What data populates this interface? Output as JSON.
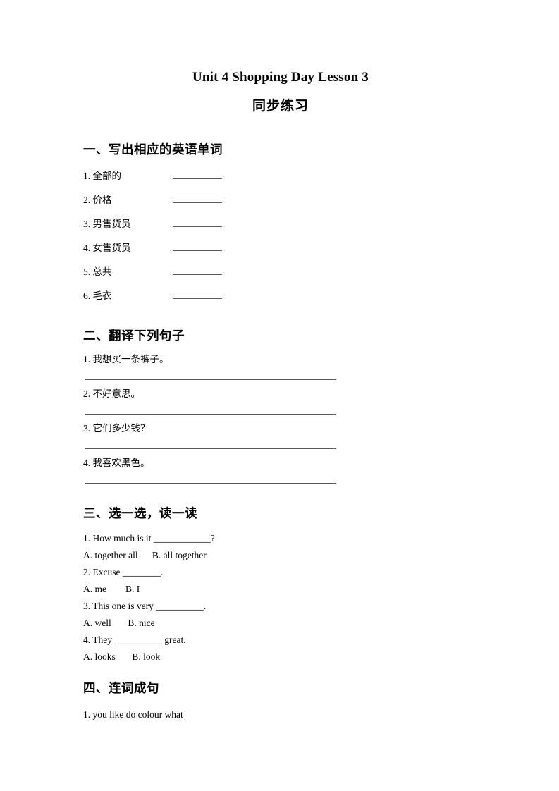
{
  "document": {
    "title": "Unit 4 Shopping Day Lesson 3",
    "subtitle": "同步练习"
  },
  "sections": [
    {
      "heading": "一、写出相应的英语单词",
      "items": [
        {
          "number": "1.",
          "text": "全部的"
        },
        {
          "number": "2.",
          "text": "价格"
        },
        {
          "number": "3.",
          "text": "男售货员"
        },
        {
          "number": "4.",
          "text": "女售货员"
        },
        {
          "number": "5.",
          "text": "总共"
        },
        {
          "number": "6.",
          "text": "毛衣"
        }
      ]
    },
    {
      "heading": "二、翻译下列句子",
      "items": [
        {
          "text": "1.  我想买一条裤子。"
        },
        {
          "text": "2.  不好意思。"
        },
        {
          "text": "3.  它们多少钱？"
        },
        {
          "text": "4.  我喜欢黑色。"
        }
      ]
    },
    {
      "heading": "三、选一选，读一读",
      "questions": [
        {
          "stem": "1. How much is it ____________?",
          "options": "A. together all      B. all together"
        },
        {
          "stem": "2. Excuse ________.",
          "options": "A. me        B. I"
        },
        {
          "stem": "3. This one is very __________.",
          "options": "A. well       B. nice"
        },
        {
          "stem": "4. They __________ great.",
          "options": "A. looks       B. look"
        }
      ]
    },
    {
      "heading": "四、连词成句",
      "items": [
        {
          "text": "1. you like do colour what"
        }
      ]
    }
  ],
  "colors": {
    "text": "#000000",
    "rule": "#5a5a5a",
    "background": "#ffffff"
  }
}
